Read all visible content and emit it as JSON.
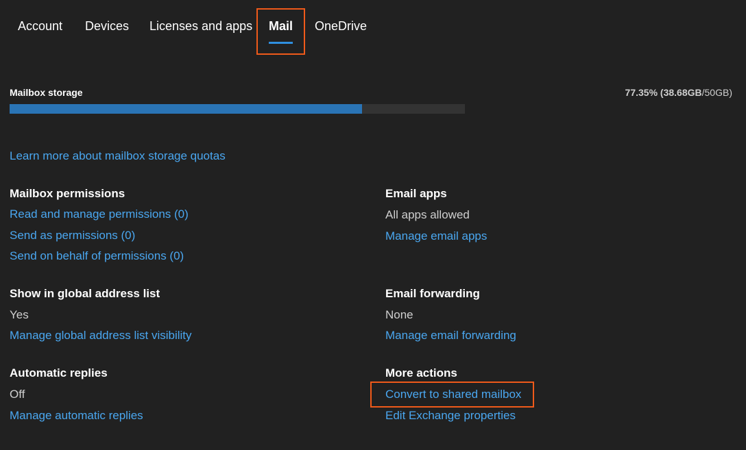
{
  "tabs": [
    {
      "label": "Account",
      "active": false
    },
    {
      "label": "Devices",
      "active": false
    },
    {
      "label": "Licenses and apps",
      "active": false
    },
    {
      "label": "Mail",
      "active": true
    },
    {
      "label": "OneDrive",
      "active": false
    }
  ],
  "storage": {
    "label": "Mailbox storage",
    "percent_text": "77.35%",
    "used_text": "38.68GB",
    "total_text": "/50GB",
    "used_fraction": 0.7735
  },
  "learn_more_link": "Learn more about mailbox storage quotas",
  "mailbox_permissions": {
    "heading": "Mailbox permissions",
    "links": [
      "Read and manage permissions (0)",
      "Send as permissions (0)",
      "Send on behalf of permissions (0)"
    ]
  },
  "email_apps": {
    "heading": "Email apps",
    "value": "All apps allowed",
    "link": "Manage email apps"
  },
  "global_address_list": {
    "heading": "Show in global address list",
    "value": "Yes",
    "link": "Manage global address list visibility"
  },
  "email_forwarding": {
    "heading": "Email forwarding",
    "value": "None",
    "link": "Manage email forwarding"
  },
  "automatic_replies": {
    "heading": "Automatic replies",
    "value": "Off",
    "link": "Manage automatic replies"
  },
  "more_actions": {
    "heading": "More actions",
    "links": [
      "Convert to shared mailbox",
      "Edit Exchange properties"
    ]
  },
  "colors": {
    "background": "#212121",
    "link": "#4aa7f0",
    "progress_fill": "#2a74b5",
    "progress_track": "#333333",
    "highlight": "#f05a1a",
    "tab_underline": "#2f8fe0"
  }
}
